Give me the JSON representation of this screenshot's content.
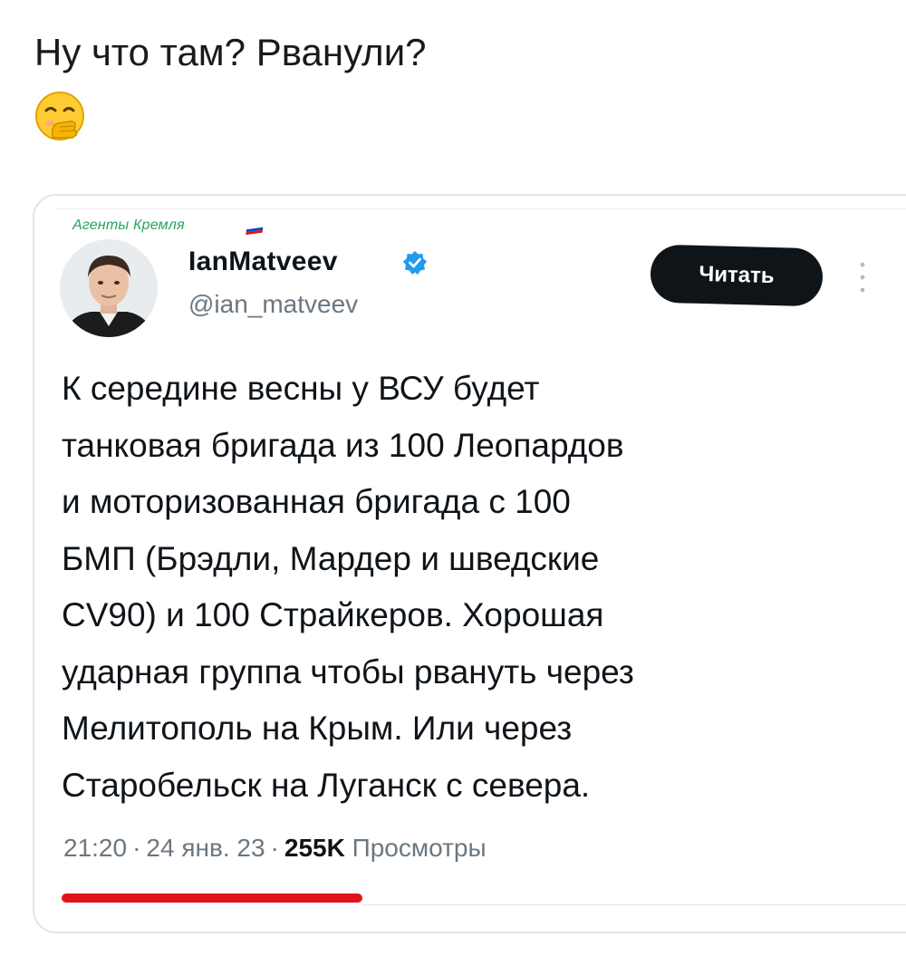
{
  "post": {
    "caption": "Ну что там? Рванули?",
    "emoji": "hand-over-mouth-emoji"
  },
  "tweet": {
    "watermark": "Агенты Кремля",
    "author": {
      "display_name": "IanMatveev",
      "handle": "@ian_matveev",
      "verified": true
    },
    "follow_label": "Читать",
    "body_lines": [
      "К середине весны у ВСУ будет",
      "танковая бригада из 100 Леопардов",
      "и моторизованная бригада с 100",
      "БМП (Брэдли, Мардер и шведские",
      "CV90) и 100 Страйкеров. Хорошая",
      "ударная группа чтобы рвануть через",
      "Мелитополь на Крым. Или через",
      "Старобельск на Луганск с севера."
    ],
    "time": "21:20",
    "date": "24 янв. 23",
    "views_count": "255K",
    "views_label": "Просмотры"
  },
  "colors": {
    "accent_red": "#e0141c",
    "verified_blue": "#1d9bf0",
    "watermark_green": "#2aa35c",
    "button_bg": "#0f1419"
  }
}
